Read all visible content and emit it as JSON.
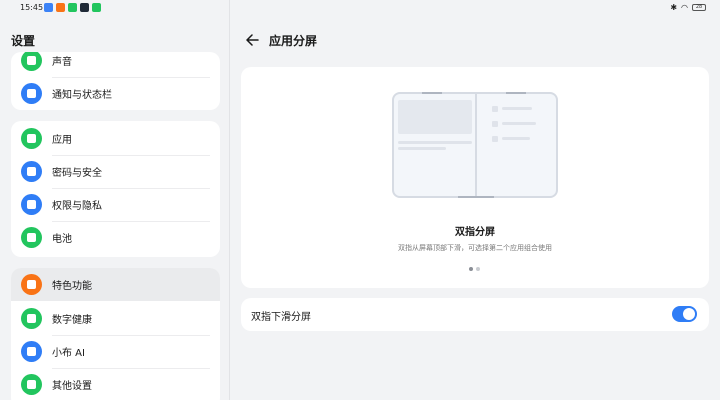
{
  "status_bar": {
    "time": "15:45",
    "battery": "28",
    "app_icon_colors": [
      "#3b82f6",
      "#f97316",
      "#22c55e",
      "#1f2937",
      "#22c55e"
    ]
  },
  "left": {
    "title": "设置",
    "groups": [
      {
        "items": [
          {
            "label": "声音",
            "icon": "bell-icon",
            "color": "#22c55e"
          },
          {
            "label": "通知与状态栏",
            "icon": "notification-icon",
            "color": "#2f7df6"
          }
        ]
      },
      {
        "items": [
          {
            "label": "应用",
            "icon": "apps-grid-icon",
            "color": "#22c55e"
          },
          {
            "label": "密码与安全",
            "icon": "key-icon",
            "color": "#2f7df6"
          },
          {
            "label": "权限与隐私",
            "icon": "shield-icon",
            "color": "#2f7df6"
          },
          {
            "label": "电池",
            "icon": "battery-icon",
            "color": "#22c55e"
          }
        ]
      },
      {
        "items": [
          {
            "label": "特色功能",
            "icon": "star-icon",
            "color": "#f97316"
          },
          {
            "label": "数字健康",
            "icon": "heart-icon",
            "color": "#22c55e"
          },
          {
            "label": "小布 AI",
            "icon": "assistant-icon",
            "color": "#2f7df6"
          },
          {
            "label": "其他设置",
            "icon": "gear-icon",
            "color": "#22c55e"
          }
        ]
      }
    ]
  },
  "right": {
    "title": "应用分屏",
    "preview": {
      "title": "双指分屏",
      "description": "双指从屏幕顶部下滑，可选择第二个应用组合使用"
    },
    "toggle": {
      "label": "双指下滑分屏",
      "enabled": true,
      "color": "#2f7df6"
    }
  }
}
